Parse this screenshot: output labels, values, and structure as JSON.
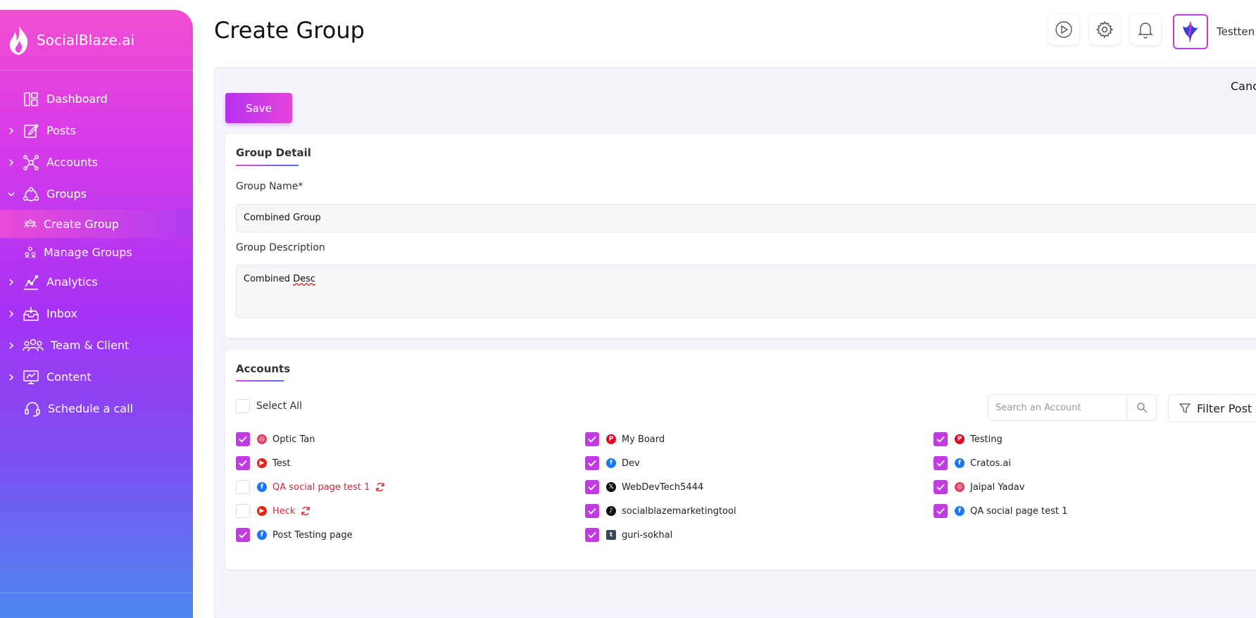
{
  "brand": {
    "name": "SocialBlaze.ai"
  },
  "sidebar": {
    "items": [
      {
        "label": "Dashboard",
        "icon": "dashboard-icon",
        "has_chevron": false
      },
      {
        "label": "Posts",
        "icon": "edit-icon",
        "has_chevron": true
      },
      {
        "label": "Accounts",
        "icon": "network-icon",
        "has_chevron": true
      },
      {
        "label": "Groups",
        "icon": "groups-icon",
        "has_chevron": true,
        "expanded": true
      }
    ],
    "sub_items": [
      {
        "label": "Create Group",
        "icon": "users-icon",
        "active": true
      },
      {
        "label": "Manage Groups",
        "icon": "manage-groups-icon",
        "active": false
      }
    ],
    "items_after": [
      {
        "label": "Analytics",
        "icon": "analytics-icon",
        "has_chevron": true
      },
      {
        "label": "Inbox",
        "icon": "inbox-icon",
        "has_chevron": true
      },
      {
        "label": "Team & Client",
        "icon": "team-icon",
        "has_chevron": true
      },
      {
        "label": "Content",
        "icon": "content-icon",
        "has_chevron": true
      },
      {
        "label": "Schedule a call",
        "icon": "headset-icon",
        "has_chevron": false
      }
    ]
  },
  "header": {
    "title": "Create Group",
    "user_name": "Testten",
    "icons": [
      "play-icon",
      "gear-icon",
      "bell-icon"
    ]
  },
  "toolbar": {
    "save_label": "Save",
    "cancel_label": "Cancel"
  },
  "group_detail": {
    "title": "Group Detail",
    "name_label": "Group Name*",
    "name_value": "Combined Group",
    "desc_label": "Group Description",
    "desc_value_1": "Combined ",
    "desc_value_2": "Desc"
  },
  "accounts": {
    "title": "Accounts",
    "select_all_label": "Select All",
    "search_placeholder": "Search an Account",
    "filter_label": "Filter Post",
    "columns": [
      [
        {
          "name": "Optic Tan",
          "platform": "instagram",
          "checked": true,
          "error": false
        },
        {
          "name": "Test",
          "platform": "youtube",
          "checked": true,
          "error": false
        },
        {
          "name": "QA social page test 1",
          "platform": "facebook",
          "checked": false,
          "error": true
        },
        {
          "name": "Heck",
          "platform": "youtube",
          "checked": false,
          "error": true
        },
        {
          "name": "Post Testing page",
          "platform": "facebook",
          "checked": true,
          "error": false
        }
      ],
      [
        {
          "name": "My Board",
          "platform": "pinterest",
          "checked": true,
          "error": false
        },
        {
          "name": "Dev",
          "platform": "facebook",
          "checked": true,
          "error": false
        },
        {
          "name": "WebDevTech5444",
          "platform": "x",
          "checked": true,
          "error": false
        },
        {
          "name": "socialblazemarketingtool",
          "platform": "tiktok",
          "checked": true,
          "error": false
        },
        {
          "name": "guri-sokhal",
          "platform": "tumblr",
          "checked": true,
          "error": false
        }
      ],
      [
        {
          "name": "Testing",
          "platform": "pinterest",
          "checked": true,
          "error": false
        },
        {
          "name": "Cratos.ai",
          "platform": "facebook",
          "checked": true,
          "error": false
        },
        {
          "name": "Jaipal Yadav",
          "platform": "instagram",
          "checked": true,
          "error": false
        },
        {
          "name": "QA social page test 1",
          "platform": "facebook",
          "checked": true,
          "error": false
        }
      ]
    ]
  },
  "colors": {
    "accent": "#c23be2",
    "error": "#d8263a",
    "facebook": "#1877f2",
    "youtube": "#e62117",
    "pinterest": "#e60023",
    "instagram": "#e4405f",
    "x": "#111111",
    "tiktok": "#111111",
    "tumblr": "#36465d"
  }
}
